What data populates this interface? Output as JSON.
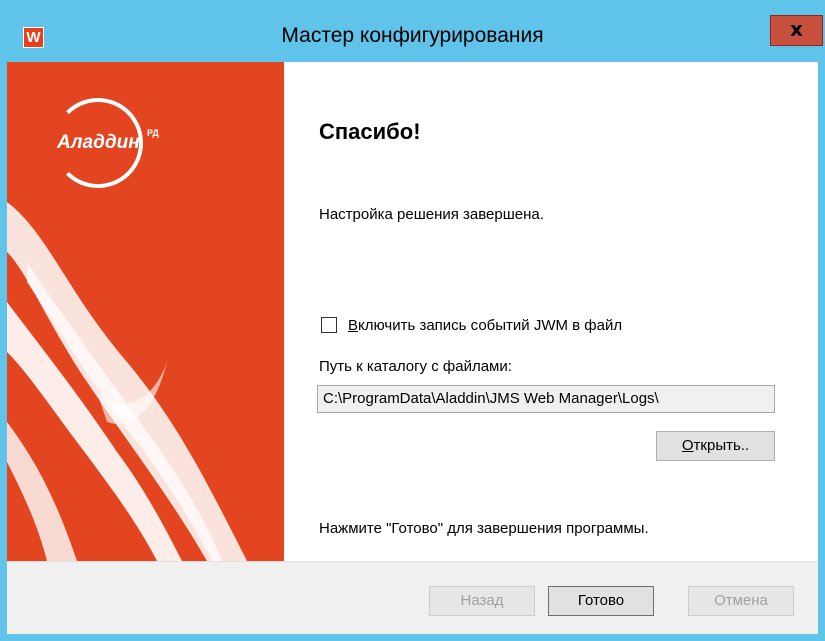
{
  "window": {
    "title": "Мастер конфигурирования",
    "app_icon_letter": "W",
    "close_glyph": "x",
    "icons": [
      "app-icon",
      "close-icon",
      "aladdin-logo"
    ]
  },
  "banner": {
    "logo_text": "Аладдин",
    "logo_sup": "РД"
  },
  "main": {
    "heading": "Спасибо!",
    "status": "Настройка решения завершена.",
    "checkbox": {
      "label_accel": "В",
      "label_rest": "ключить запись событий JWM в файл",
      "checked": false
    },
    "path_label": "Путь к каталогу с файлами:",
    "path_value": "C:\\ProgramData\\Aladdin\\JMS Web Manager\\Logs\\",
    "open_button_accel": "О",
    "open_button_rest": "ткрыть..",
    "finish_hint": "Нажмите \"Готово\" для завершения программы."
  },
  "footer": {
    "back_label": "Назад",
    "finish_label": "Готово",
    "cancel_label": "Отмена"
  },
  "colors": {
    "titlebar": "#5fc3ea",
    "banner": "#e2451f",
    "close": "#c7503e"
  }
}
